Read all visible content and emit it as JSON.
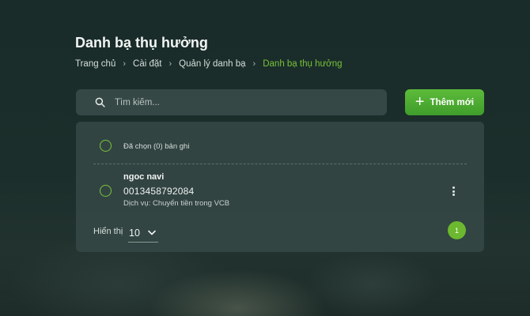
{
  "page": {
    "title": "Danh bạ thụ hưởng"
  },
  "breadcrumb": {
    "items": [
      "Trang chủ",
      "Cài đặt",
      "Quản lý danh bạ",
      "Danh bạ thụ hưởng"
    ],
    "separator": "›"
  },
  "search": {
    "placeholder": "Tìm kiếm...",
    "value": "",
    "icon": "search-icon"
  },
  "toolbar": {
    "add_label": "Thêm mới",
    "add_icon": "plus-icon"
  },
  "selection": {
    "label": "Đã chọn (0) bản ghi"
  },
  "contacts": [
    {
      "name": "ngoc navi",
      "account": "0013458792084",
      "service": "Dịch vụ: Chuyển tiền trong VCB"
    }
  ],
  "pagination": {
    "page_size_label": "Hiển thị",
    "page_size": "10",
    "current_page": "1"
  },
  "colors": {
    "accent": "#6cb82f",
    "breadcrumb_current": "#79c13a",
    "panel": "#344644",
    "background": "#1b2e2b"
  }
}
